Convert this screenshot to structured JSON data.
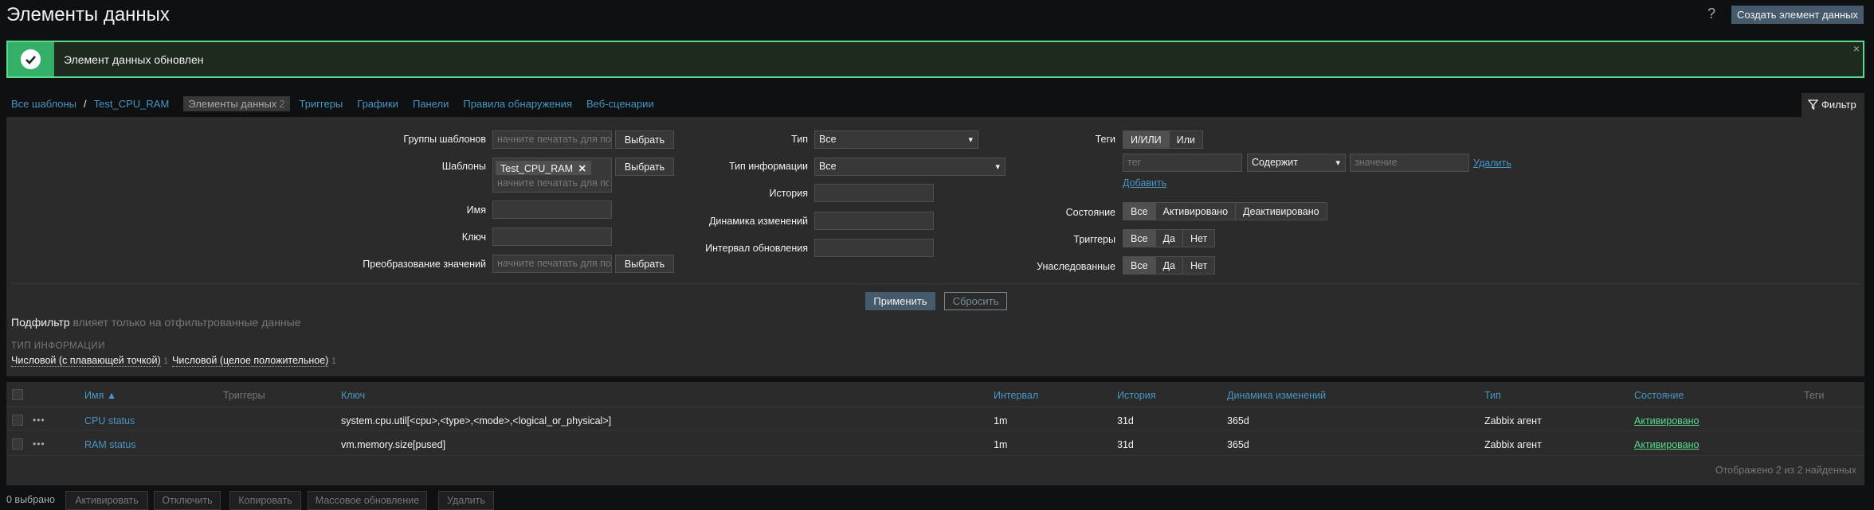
{
  "header": {
    "title": "Элементы данных",
    "help_icon": "?",
    "create_button": "Создать элемент данных"
  },
  "message": {
    "text": "Элемент данных обновлен",
    "close": "×",
    "icon": "check-icon"
  },
  "breadcrumbs": {
    "all_templates": "Все шаблоны",
    "separator": "/",
    "template": "Test_CPU_RAM",
    "items_label": "Элементы данных",
    "items_count": "2",
    "triggers": "Триггеры",
    "graphs": "Графики",
    "dashboards": "Панели",
    "discovery": "Правила обнаружения",
    "web": "Веб-сценарии"
  },
  "filter_tab": "Фильтр",
  "filter": {
    "host_groups": {
      "label": "Группы шаблонов",
      "placeholder": "начните печатать для поиска",
      "button": "Выбрать"
    },
    "templates": {
      "label": "Шаблоны",
      "chip": "Test_CPU_RAM",
      "placeholder": "начните печатать для поиска",
      "button": "Выбрать"
    },
    "name": {
      "label": "Имя",
      "value": ""
    },
    "key": {
      "label": "Ключ",
      "value": ""
    },
    "value_mapping": {
      "label": "Преобразование значений",
      "placeholder": "начните печатать для поиска",
      "button": "Выбрать"
    },
    "type": {
      "label": "Тип",
      "value": "Все"
    },
    "info_type": {
      "label": "Тип информации",
      "value": "Все"
    },
    "history": {
      "label": "История",
      "value": ""
    },
    "trends": {
      "label": "Динамика изменений",
      "value": ""
    },
    "interval": {
      "label": "Интервал обновления",
      "value": ""
    },
    "tags": {
      "label": "Теги",
      "and_or": "И/ИЛИ",
      "or": "Или",
      "tag_placeholder": "тег",
      "operator": "Содержит",
      "value_placeholder": "значение",
      "remove": "Удалить",
      "add": "Добавить"
    },
    "state": {
      "label": "Состояние",
      "options": [
        "Все",
        "Активировано",
        "Деактивировано"
      ],
      "selected": "Все"
    },
    "triggers": {
      "label": "Триггеры",
      "options": [
        "Все",
        "Да",
        "Нет"
      ],
      "selected": "Все"
    },
    "inherited": {
      "label": "Унаследованные",
      "options": [
        "Все",
        "Да",
        "Нет"
      ],
      "selected": "Все"
    },
    "apply": "Применить",
    "reset": "Сбросить"
  },
  "subfilter": {
    "title": "Подфильтр",
    "hint": "влияет только на отфильтрованные данные",
    "section": "ТИП ИНФОРМАЦИИ",
    "options": [
      {
        "label": "Числовой (с плавающей точкой)",
        "count": "1"
      },
      {
        "label": "Числовой (целое положительное)",
        "count": "1"
      }
    ]
  },
  "table": {
    "columns": {
      "name": "Имя ▲",
      "triggers": "Триггеры",
      "key": "Ключ",
      "interval": "Интервал",
      "history": "История",
      "trends": "Динамика изменений",
      "type": "Тип",
      "status": "Состояние",
      "tags": "Теги"
    },
    "rows": [
      {
        "menu": "•••",
        "name": "CPU status",
        "triggers": "",
        "key": "system.cpu.util[<cpu>,<type>,<mode>,<logical_or_physical>]",
        "interval": "1m",
        "history": "31d",
        "trends": "365d",
        "type": "Zabbix агент",
        "status": "Активировано",
        "tags": ""
      },
      {
        "menu": "•••",
        "name": "RAM status",
        "triggers": "",
        "key": "vm.memory.size[pused]",
        "interval": "1m",
        "history": "31d",
        "trends": "365d",
        "type": "Zabbix агент",
        "status": "Активировано",
        "tags": ""
      }
    ],
    "summary": "Отображено 2 из 2 найденных"
  },
  "footer": {
    "selected": "0 выбрано",
    "buttons": [
      "Активировать",
      "Отключить",
      "Копировать",
      "Массовое обновление",
      "Удалить"
    ]
  }
}
